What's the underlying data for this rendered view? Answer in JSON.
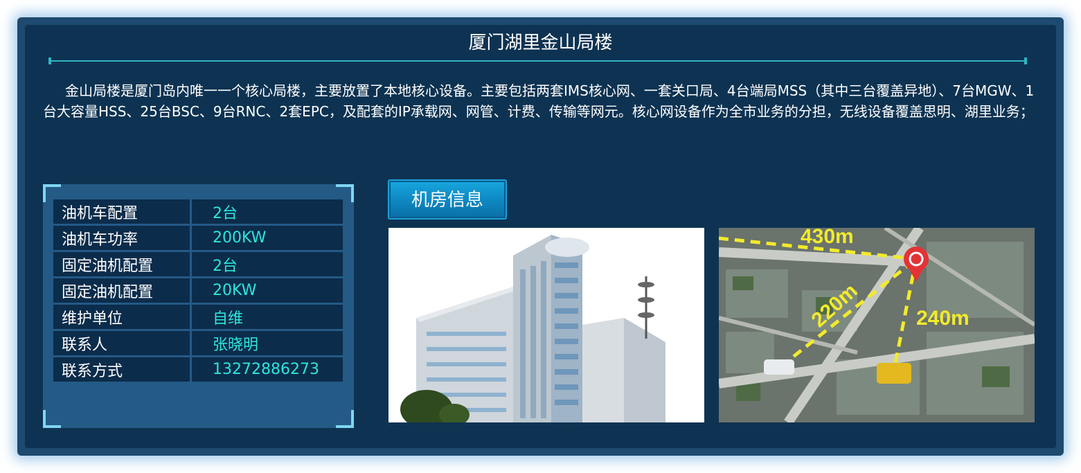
{
  "header": {
    "title": "厦门湖里金山局楼"
  },
  "description": "金山局楼是厦门岛内唯一一个核心局楼，主要放置了本地核心设备。主要包括两套IMS核心网、一套关口局、4台端局MSS（其中三台覆盖异地）、7台MGW、1台大容量HSS、25台BSC、9台RNC、2套EPC，及配套的IP承载网、网管、计费、传输等网元。核心网设备作为全市业务的分担，无线设备覆盖思明、湖里业务；",
  "info": {
    "rows": [
      {
        "label": "油机车配置",
        "value": "2台"
      },
      {
        "label": "油机车功率",
        "value": "200KW"
      },
      {
        "label": "固定油机配置",
        "value": "2台"
      },
      {
        "label": "固定油机配置",
        "value": "20KW"
      },
      {
        "label": "维护单位",
        "value": "自维"
      },
      {
        "label": "联系人",
        "value": "张晓明"
      },
      {
        "label": "联系方式",
        "value": "13272886273"
      }
    ]
  },
  "room_button": {
    "label": "机房信息"
  },
  "map": {
    "labels": [
      "430m",
      "220m",
      "240m"
    ]
  },
  "colors": {
    "page_bg": "#ffffff",
    "panel_bg": "#0e3352",
    "frame": "#1d4a6e",
    "accent_text": "#2ee6da",
    "rule": "#2fb6c2",
    "button": "#0f8cc6"
  }
}
